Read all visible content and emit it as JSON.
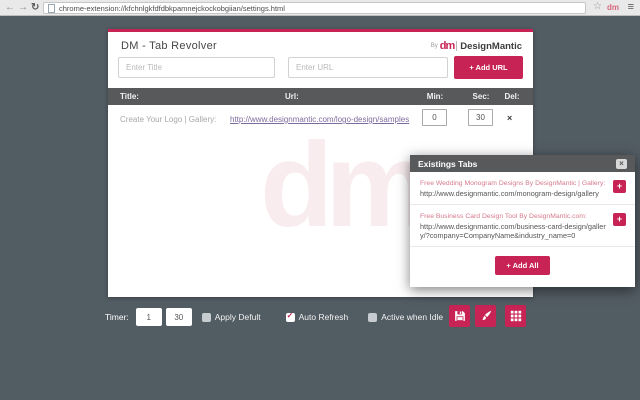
{
  "browser": {
    "url": "chrome-extension://kfchnlgkfdfdbkpamnejckockobgiian/settings.html",
    "extension_icon": "dm"
  },
  "icons": {
    "back": "←",
    "forward": "→",
    "reload": "↻",
    "star": "☆",
    "menu": "≡",
    "close": "×",
    "delete": "×",
    "check": "✓",
    "plus": "+"
  },
  "header": {
    "title": "DM - Tab Revolver",
    "logo_by": "By",
    "logo_dm": "dm",
    "logo_name": "DesignMantic"
  },
  "add_form": {
    "title_placeholder": "Enter Title",
    "url_placeholder": "Enter URL",
    "add_button": "+ Add URL"
  },
  "table": {
    "headers": [
      "Title:",
      "Url:",
      "Min:",
      "Sec:",
      "Del:"
    ],
    "rows": [
      {
        "title": "Create Your Logo | Gallery:",
        "url": "http://www.designmantic.com/logo-design/samples",
        "min": "0",
        "sec": "30"
      }
    ]
  },
  "existing_tabs": {
    "title": "Existings Tabs",
    "items": [
      {
        "title": "Free Wedding Monogram Designs By DesignMantic | Gallery:",
        "url": "http://www.designmantic.com/monogram-design/gallery"
      },
      {
        "title": "Free Business Card Design Tool By DesignMantic.com:",
        "url": "http://www.designmantic.com/business-card-design/gallery/?company=CompanyName&industry_name=0"
      }
    ],
    "add_all": "+ Add All"
  },
  "timer_bar": {
    "label": "Timer:",
    "min_value": "1",
    "sec_value": "30",
    "checkboxes": [
      {
        "label": "Apply Defult",
        "checked": false
      },
      {
        "label": "Auto Refresh",
        "checked": true
      },
      {
        "label": "Active when Idle",
        "checked": false
      }
    ]
  },
  "watermark": "dm",
  "colors": {
    "accent": "#c72455",
    "page_bg": "#525c63",
    "bar": "#58595b",
    "link": "#7e6b9d",
    "pink": "#d4798d",
    "watermark": "#f8ecef"
  }
}
